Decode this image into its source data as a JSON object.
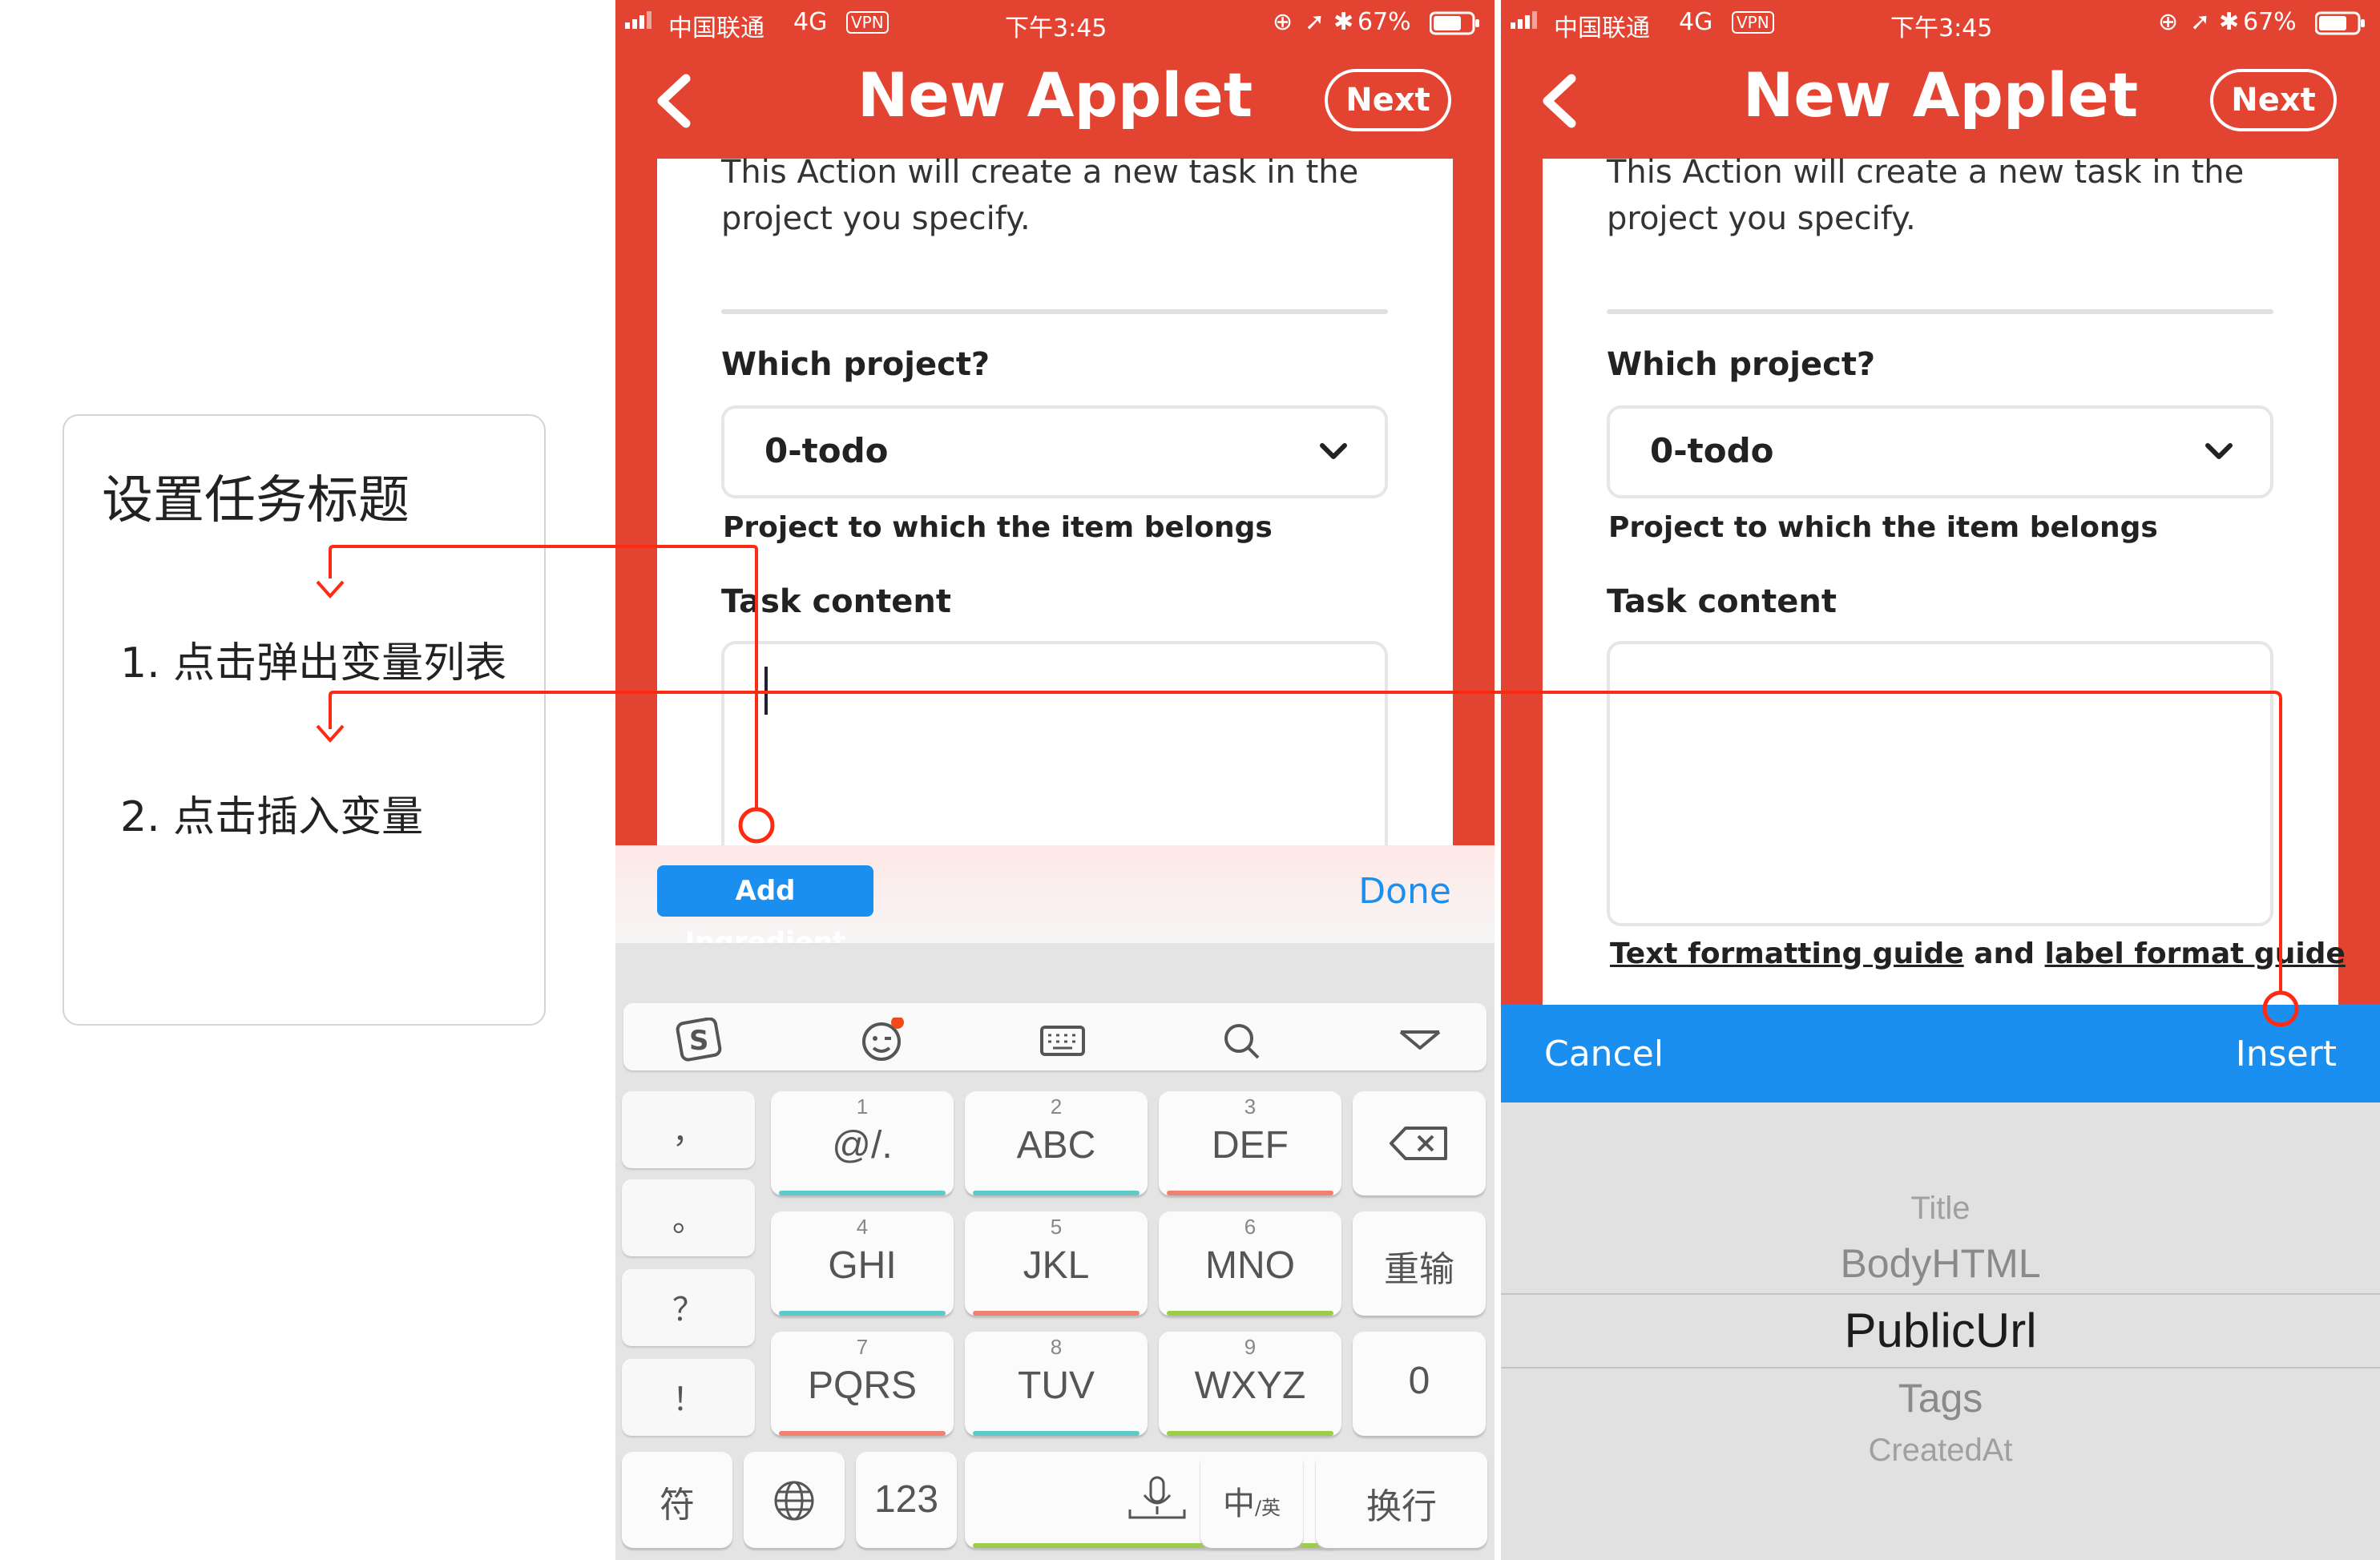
{
  "annotation": {
    "title": "设置任务标题",
    "step1": "1. 点击弹出变量列表",
    "step2": "2. 点击插入变量"
  },
  "status_bar": {
    "carrier": "中国联通",
    "network": "4G",
    "vpn": "VPN",
    "time": "下午3:45",
    "battery": "67%"
  },
  "nav": {
    "title": "New Applet",
    "next_label": "Next",
    "back_icon": "chevron-left-icon"
  },
  "form": {
    "description": "This Action will create a new task in the project you specify.",
    "project_label": "Which project?",
    "project_value": "0-todo",
    "project_help": "Project to which the item belongs",
    "task_label": "Task content",
    "formatting_prefix": "Text formatting guide",
    "formatting_and": "and",
    "formatting_suffix": "label format guide"
  },
  "ingredient_bar": {
    "add_label": "Add Ingredient",
    "done_label": "Done"
  },
  "keyboard": {
    "toolbar_icons": [
      "sogou-logo-icon",
      "emoji-icon",
      "keyboard-icon",
      "search-icon",
      "collapse-icon"
    ],
    "side_keys": [
      "，",
      "。",
      "？",
      "！"
    ],
    "keys": [
      {
        "num": "1",
        "letters": "@/."
      },
      {
        "num": "2",
        "letters": "ABC"
      },
      {
        "num": "3",
        "letters": "DEF"
      },
      {
        "num": "4",
        "letters": "GHI"
      },
      {
        "num": "5",
        "letters": "JKL"
      },
      {
        "num": "6",
        "letters": "MNO"
      },
      {
        "num": "7",
        "letters": "PQRS"
      },
      {
        "num": "8",
        "letters": "TUV"
      },
      {
        "num": "9",
        "letters": "WXYZ"
      }
    ],
    "retype_label": "重输",
    "zero_label": "0",
    "symbols_label": "符",
    "numbers_label": "123",
    "lang_label": "中",
    "lang_sub": "/英",
    "enter_label": "换行",
    "accent_colors": {
      "teal": "#5ec9c9",
      "coral": "#f08070",
      "green": "#9ccc48"
    }
  },
  "insert_bar": {
    "cancel_label": "Cancel",
    "insert_label": "Insert"
  },
  "picker": {
    "items": [
      "Title",
      "BodyHTML",
      "PublicUrl",
      "Tags",
      "CreatedAt"
    ],
    "selected": "PublicUrl"
  },
  "colors": {
    "ifttt_red": "#e34432",
    "accent_blue": "#1a8ff0",
    "guide_line": "#ff2a12"
  }
}
